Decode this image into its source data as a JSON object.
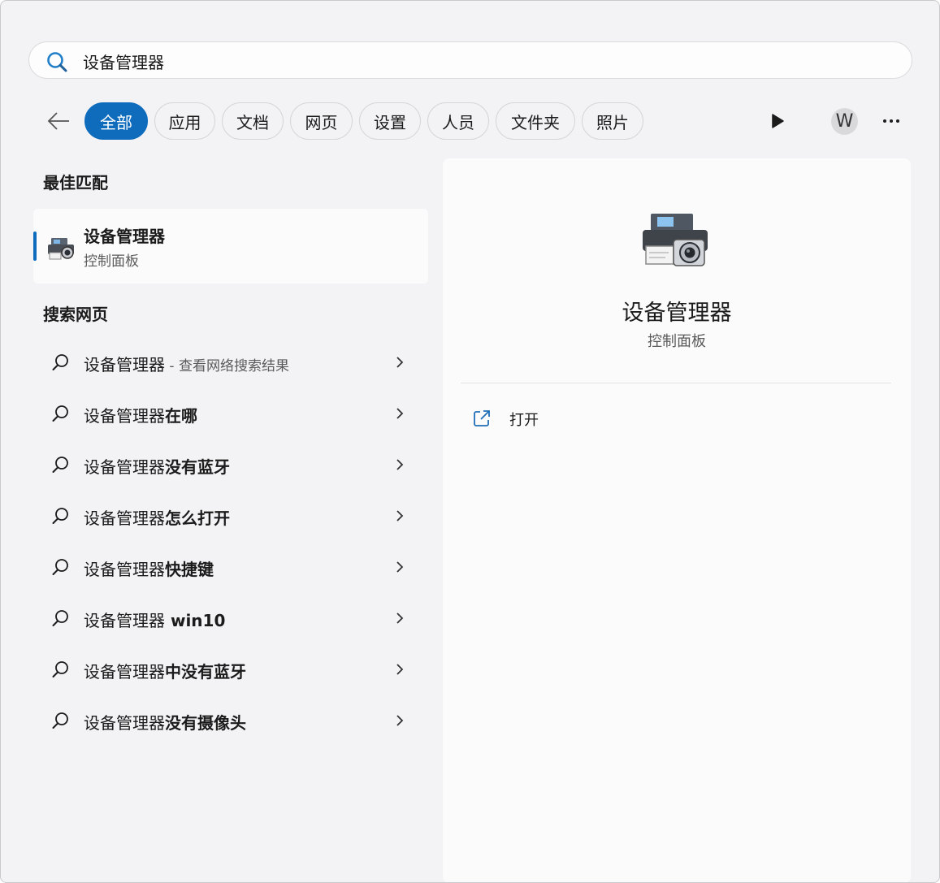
{
  "search": {
    "value": "设备管理器",
    "icon": "search-icon"
  },
  "filters": {
    "back_icon": "back-arrow-icon",
    "chips": [
      "全部",
      "应用",
      "文档",
      "网页",
      "设置",
      "人员",
      "文件夹",
      "照片"
    ],
    "active_chip": "全部",
    "play_icon": "play-icon",
    "avatar_letter": "W",
    "more_icon": "more-icon"
  },
  "best_match": {
    "heading": "最佳匹配",
    "title": "设备管理器",
    "subtitle": "控制面板",
    "icon": "device-manager-icon"
  },
  "web_search": {
    "heading": "搜索网页",
    "items": [
      {
        "prefix": "设备管理器",
        "bold": "",
        "sub": " - 查看网络搜索结果"
      },
      {
        "prefix": "设备管理器",
        "bold": "在哪",
        "sub": ""
      },
      {
        "prefix": "设备管理器",
        "bold": "没有蓝牙",
        "sub": ""
      },
      {
        "prefix": "设备管理器",
        "bold": "怎么打开",
        "sub": ""
      },
      {
        "prefix": "设备管理器",
        "bold": "快捷键",
        "sub": ""
      },
      {
        "prefix": "设备管理器",
        "bold": " win10",
        "sub": ""
      },
      {
        "prefix": "设备管理器",
        "bold": "中没有蓝牙",
        "sub": ""
      },
      {
        "prefix": "设备管理器",
        "bold": "没有摄像头",
        "sub": ""
      }
    ]
  },
  "preview": {
    "title": "设备管理器",
    "subtitle": "控制面板",
    "open_label": "打开",
    "open_icon": "open-external-icon"
  },
  "colors": {
    "accent": "#0f6cbd",
    "panel_bg": "#f3f3f5",
    "card_bg": "#fbfbfc"
  }
}
